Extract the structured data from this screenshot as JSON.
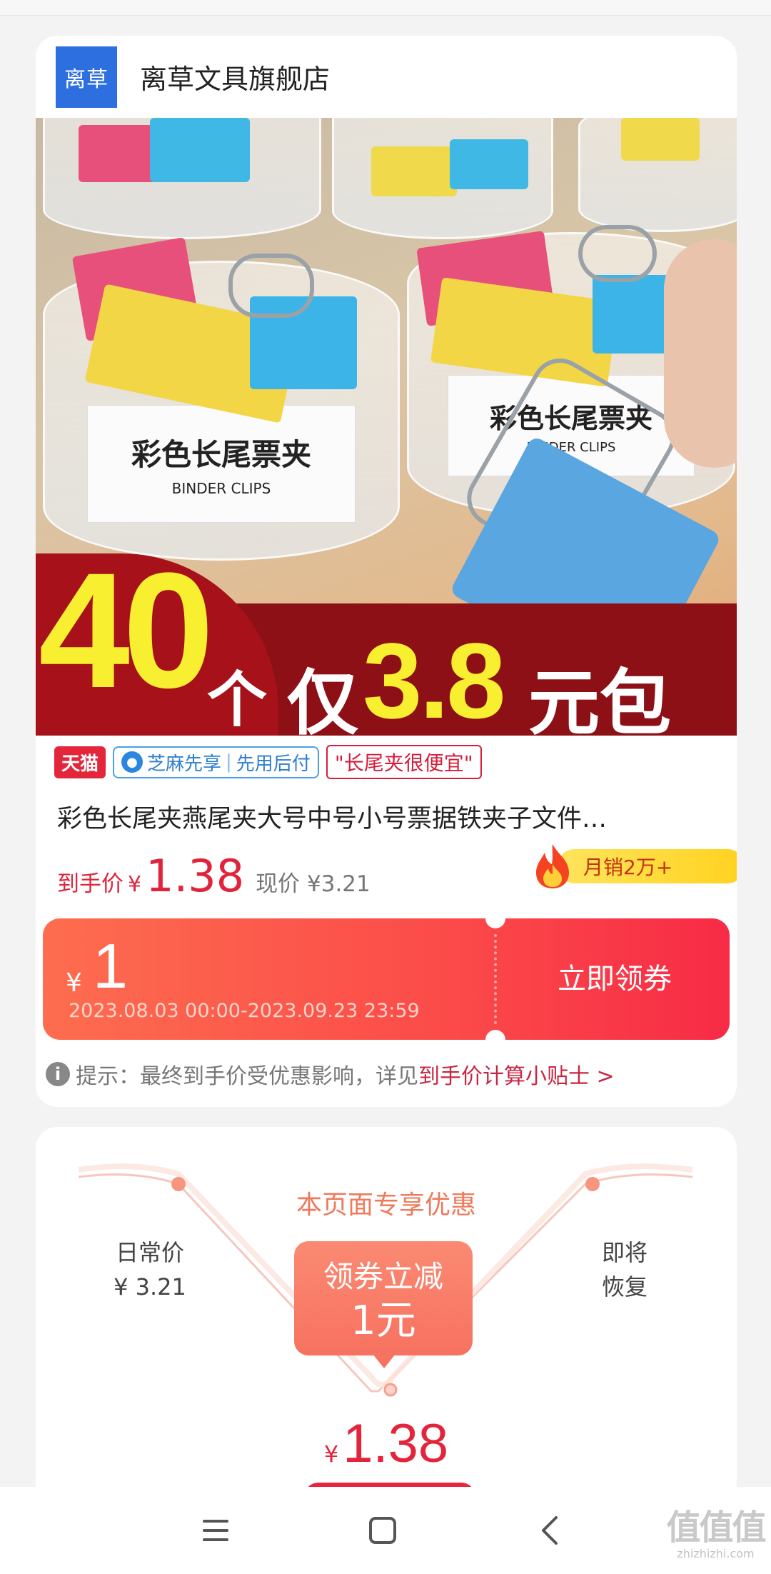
{
  "store": {
    "logo_text": "离草",
    "name": "离草文具旗舰店"
  },
  "banner": {
    "jar_label_cn": "彩色长尾票夹",
    "jar_label_en": "BINDER CLIPS",
    "promo_count": "40",
    "promo_unit": "个",
    "promo_only": "仅",
    "promo_price": "3.8",
    "promo_suffix": "元包邮"
  },
  "tags": {
    "platform": "天猫",
    "zhima": "芝麻先享",
    "pay_later": "先用后付",
    "quote": "\"长尾夹很便宜\""
  },
  "product": {
    "title": "彩色长尾夹燕尾夹大号中号小号票据铁夹子文件…"
  },
  "price": {
    "final_label": "到手价",
    "currency": "¥",
    "final_value": "1.38",
    "current": "现价 ¥3.21",
    "monthly_sales": "月销2万+"
  },
  "coupon": {
    "currency": "¥",
    "amount": "1",
    "validity": "2023.08.03 00:00-2023.09.23 23:59",
    "action": "立即领券"
  },
  "tip": {
    "text": "提示：最终到手价受优惠影响，详见",
    "link": "到手价计算小贴士 >"
  },
  "offer": {
    "title": "本页面专享优惠",
    "left_line1": "日常价",
    "left_line2": "¥ 3.21",
    "right_line1": "即将",
    "right_line2": "恢复",
    "bubble_line1": "领券立减",
    "bubble_line2": "1元",
    "currency": "¥",
    "price": "1.38"
  },
  "navbar": {
    "menu_icon": "menu-icon",
    "home_icon": "home-square-icon",
    "back_icon": "back-icon"
  },
  "watermark": {
    "site": "zhizhizhi.com"
  },
  "colors": {
    "accent_red": "#e0243b",
    "coupon_start": "#fd6d4f",
    "coupon_end": "#f72b46",
    "store_blue": "#2e6fe0"
  }
}
